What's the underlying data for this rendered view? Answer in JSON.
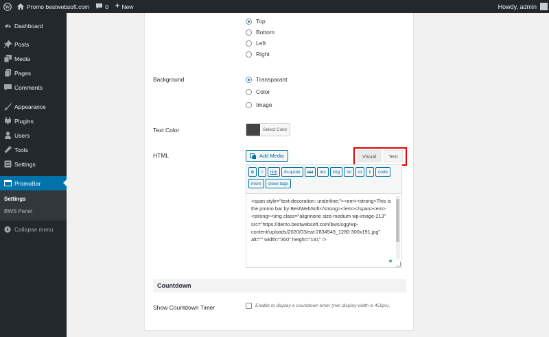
{
  "adminbar": {
    "site_name": "Promo bestwebsoft.com",
    "comments_count": "0",
    "new_label": "New",
    "greeting": "Howdy, admin"
  },
  "sidebar": {
    "items": [
      {
        "label": "Dashboard",
        "icon": "dashboard-icon"
      },
      {
        "label": "Posts",
        "icon": "pin-icon"
      },
      {
        "label": "Media",
        "icon": "media-icon"
      },
      {
        "label": "Pages",
        "icon": "pages-icon"
      },
      {
        "label": "Comments",
        "icon": "comments-icon"
      },
      {
        "label": "Appearance",
        "icon": "brush-icon"
      },
      {
        "label": "Plugins",
        "icon": "plugin-icon"
      },
      {
        "label": "Users",
        "icon": "users-icon"
      },
      {
        "label": "Tools",
        "icon": "wrench-icon"
      },
      {
        "label": "Settings",
        "icon": "settings-icon"
      },
      {
        "label": "PromoBar",
        "icon": "promobar-icon"
      }
    ],
    "submenu": [
      "Settings",
      "BWS Panel"
    ],
    "collapse_label": "Collapse menu"
  },
  "form": {
    "position_options": [
      "Top",
      "Bottom",
      "Left",
      "Right"
    ],
    "position_selected": "Top",
    "background_label": "Background",
    "background_options": [
      "Transparant",
      "Color",
      "Image"
    ],
    "background_selected": "Transparant",
    "text_color_label": "Text Color",
    "select_color_label": "Select Color",
    "text_color_value": "#444444",
    "html_label": "HTML",
    "add_media_label": "Add Media",
    "tab_visual": "Visual",
    "tab_text": "Text",
    "quicktags": [
      "b",
      "i",
      "link",
      "/b-quote",
      "del",
      "ins",
      "img",
      "/ul",
      "ol",
      "li",
      "code",
      "more",
      "close tags"
    ],
    "editor_content": "<span style=\"text-decoration: underline;\"><em><strong>This is the promo bar by BestWebSoft</strong></em></span><em><strong><img class=\"alignnone size-medium wp-image-213\" src=\"https://demo.bestwebsoft.com/bws/sgg/wp-content/uploads/2020/03/eat-2834549_1280-300x191.jpg\" alt=\"\" width=\"300\" height=\"191\" />",
    "countdown_heading": "Countdown",
    "show_countdown_label": "Show Countdown Timer",
    "countdown_desc": "Enable to display a countdown timer (min display width is 450px)."
  },
  "colors": {
    "admin_dark": "#23282d",
    "accent_blue": "#0073aa",
    "highlight_red": "#e00000"
  }
}
